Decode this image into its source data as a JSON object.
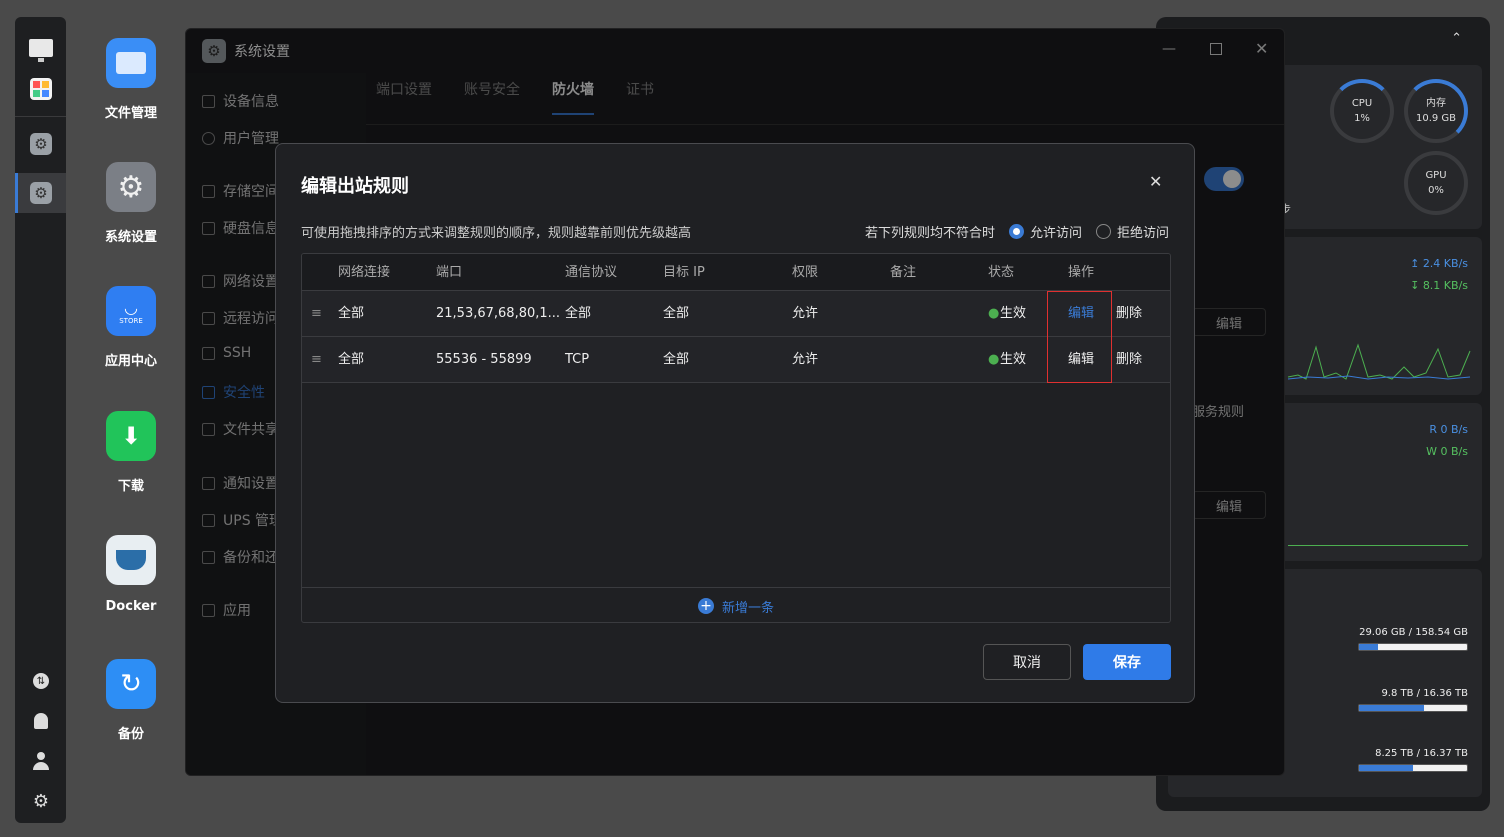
{
  "desktop": {
    "icons": [
      {
        "label": "文件管理",
        "color": "#3a8ef6"
      },
      {
        "label": "系统设置",
        "color": "#7b7f86"
      },
      {
        "label": "应用中心",
        "color": "#2f7ef2",
        "sub": "STORE"
      },
      {
        "label": "下载",
        "color": "#21c45a"
      },
      {
        "label": "Docker",
        "color": "#e8eef2"
      },
      {
        "label": "备份",
        "color": "#2d8ef5"
      }
    ]
  },
  "dock": {
    "icons": [
      "monitor-icon",
      "apps-icon",
      "settings-icon",
      "settings-icon-active",
      "sync-icon",
      "bell-icon",
      "user-icon",
      "gear-icon"
    ]
  },
  "right_panel": {
    "cpu_label": "CPU",
    "cpu_value": "1%",
    "cpu_usage": 0.01,
    "mem_label": "内存",
    "mem_value": "10.9 GB",
    "mem_usage": 0.68,
    "gpu_label": "GPU",
    "gpu_value": "0%",
    "partial_text": "步",
    "net_up": "2.4 KB/s",
    "net_down": "8.1 KB/s",
    "disk_r": "R  0 B/s",
    "disk_w": "W  0 B/s",
    "storage": [
      {
        "text": "29.06 GB / 158.54 GB",
        "fill": 0.18
      },
      {
        "text": "9.8 TB / 16.36 TB",
        "fill": 0.6
      },
      {
        "text": "8.25 TB / 16.37 TB",
        "fill": 0.5
      }
    ]
  },
  "window": {
    "title": "系统设置",
    "sidebar": [
      "设备信息",
      "用户管理",
      "存储空间",
      "硬盘信息",
      "网络设置",
      "远程访问",
      "SSH",
      "安全性",
      "文件共享",
      "通知设置",
      "UPS 管理",
      "备份和还原",
      "应用"
    ],
    "tabs": [
      "端口设置",
      "账号安全",
      "防火墙",
      "证书"
    ],
    "bg_buttons": [
      "编辑",
      "编辑"
    ],
    "bg_text": "服务规则"
  },
  "modal": {
    "title": "编辑出站规则",
    "description": "可使用拖拽排序的方式来调整规则的顺序，规则越靠前则优先级越高",
    "default_label": "若下列规则均不符合时",
    "allow_label": "允许访问",
    "deny_label": "拒绝访问",
    "headers": [
      "网络连接",
      "端口",
      "通信协议",
      "目标 IP",
      "权限",
      "备注",
      "状态",
      "操作"
    ],
    "rows": [
      {
        "network": "全部",
        "port": "21,53,67,68,80,1...",
        "protocol": "全部",
        "target": "全部",
        "permission": "允许",
        "note": "",
        "status": "生效",
        "edit": "编辑",
        "delete": "删除"
      },
      {
        "network": "全部",
        "port": "55536 - 55899",
        "protocol": "TCP",
        "target": "全部",
        "permission": "允许",
        "note": "",
        "status": "生效",
        "edit": "编辑",
        "delete": "删除"
      }
    ],
    "add_label": "新增一条",
    "cancel": "取消",
    "save": "保存"
  },
  "colors": {
    "accent": "#3a7bd5",
    "status_green": "#4caf50",
    "highlight_red": "#e03030"
  }
}
